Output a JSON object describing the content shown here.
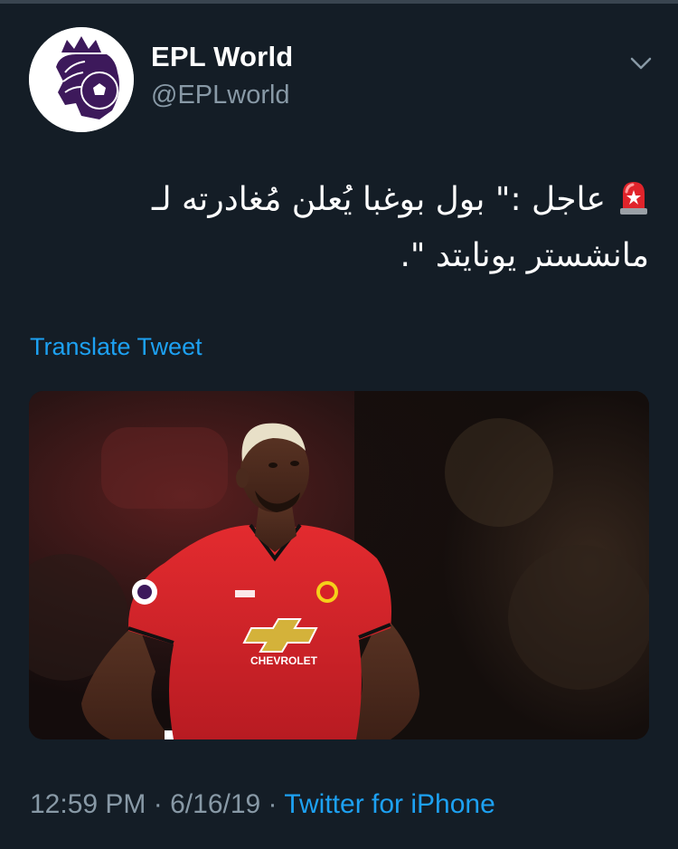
{
  "header": {
    "display_name": "EPL World",
    "handle": "@EPLworld",
    "avatar_icon": "premier-league-lion-icon",
    "menu_icon": "chevron-down-icon"
  },
  "tweet": {
    "emoji_icon": "police-siren-icon",
    "text": "عاجل :\" بول بوغبا يُعلن مُغادرته لـ مانشستر يونايتد \".",
    "translate_label": "Translate Tweet",
    "media_icon": "photo-icon",
    "kit_sponsor": "CHEVROLET",
    "time": "12:59 PM",
    "separator": "·",
    "date": "6/16/19",
    "source": "Twitter for iPhone"
  },
  "colors": {
    "background": "#141d26",
    "link": "#1da1f2",
    "secondary_text": "#8899a6",
    "avatar_purple": "#3d195b",
    "kit_red": "#d9262b"
  }
}
